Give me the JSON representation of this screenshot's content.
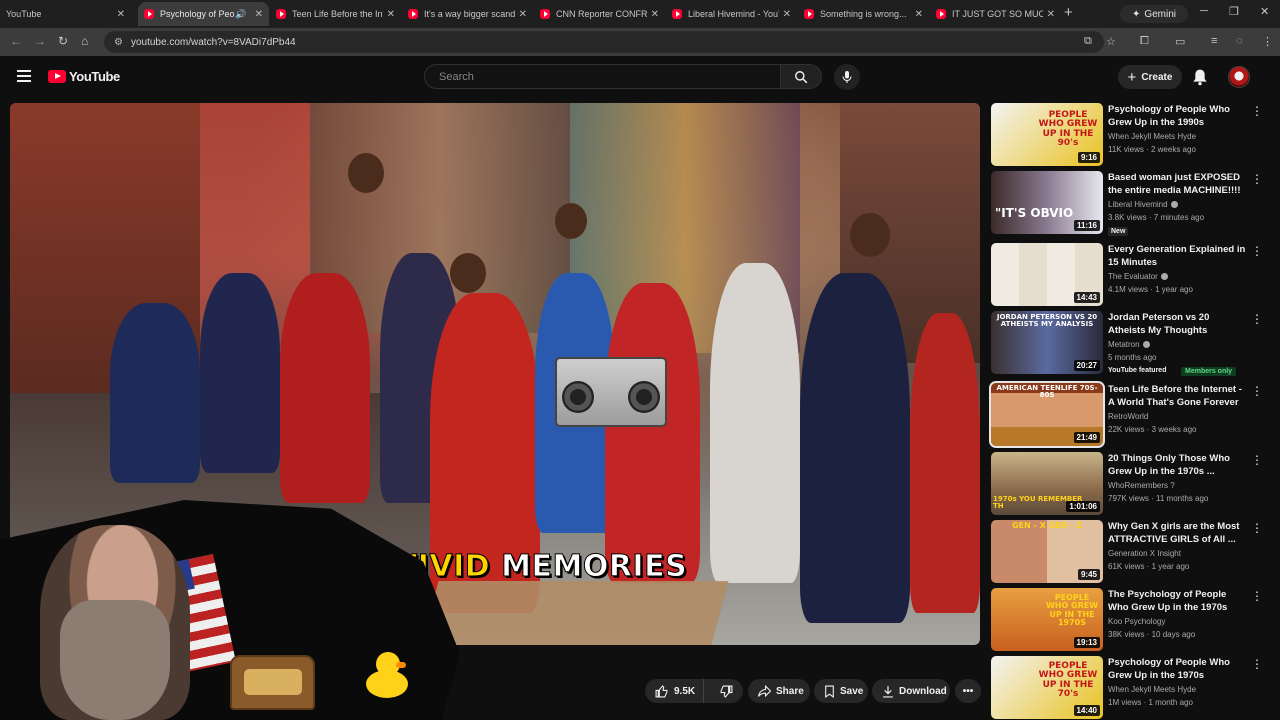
{
  "browser": {
    "tabs": [
      {
        "title": "YouTube",
        "active": false
      },
      {
        "title": "Psychology of People Who Grew Up",
        "active": true
      },
      {
        "title": "Teen Life Before the Internet",
        "active": false
      },
      {
        "title": "It's a way bigger scandal",
        "active": false
      },
      {
        "title": "CNN Reporter CONFRONTED",
        "active": false
      },
      {
        "title": "Liberal Hivemind - YouTube",
        "active": false
      },
      {
        "title": "Something is wrong...",
        "active": false
      },
      {
        "title": "IT JUST GOT SO MUCH",
        "active": false
      }
    ],
    "gemini_label": "Gemini",
    "url": "youtube.com/watch?v=8VADi7dPb44"
  },
  "masthead": {
    "logo_text": "YouTube",
    "search_placeholder": "Search",
    "create_label": "Create"
  },
  "player": {
    "caption_word1": "VIVID",
    "caption_word2": "MEMORIES"
  },
  "actions": {
    "like_count": "9.5K",
    "share_label": "Share",
    "save_label": "Save",
    "download_label": "Download"
  },
  "recommendations": [
    {
      "title": "Psychology of People Who Grew Up in the 1990s",
      "channel": "When Jekyll Meets Hyde",
      "verified": false,
      "meta": "11K views · 2 weeks ago",
      "duration": "9:16",
      "thumb_text": "PEOPLE WHO GREW UP IN THE 90's"
    },
    {
      "title": "Based woman just EXPOSED the entire media MACHINE!!!!",
      "channel": "Liberal Hivemind",
      "verified": true,
      "meta": "3.8K views · 7 minutes ago",
      "duration": "11:16",
      "badge": "New",
      "thumb_text": "\"IT'S OBVIO"
    },
    {
      "title": "Every Generation Explained in 15 Minutes",
      "channel": "The Evaluator",
      "verified": true,
      "meta": "4.1M views · 1 year ago",
      "duration": "14:43",
      "thumb_text": ""
    },
    {
      "title": "Jordan Peterson vs 20 Atheists My Thoughts",
      "channel": "Metatron",
      "verified": true,
      "meta": "5 months ago",
      "duration": "20:27",
      "badge": "YouTube featured",
      "badge2": "Members only",
      "thumb_text": "JORDAN PETERSON VS 20 ATHEISTS MY ANALYSIS"
    },
    {
      "title": "Teen Life Before the Internet - A World That's Gone Forever",
      "channel": "RetroWorld",
      "verified": false,
      "meta": "22K views · 3 weeks ago",
      "duration": "21:49",
      "selected": true,
      "thumb_text": "AMERICAN TEENLIFE 70S-80S"
    },
    {
      "title": "20 Things Only Those Who Grew Up in the 1970s ...",
      "channel": "WhoRemembers ?",
      "verified": false,
      "meta": "797K views · 11 months ago",
      "duration": "1:01:06",
      "thumb_text": "1970s YOU REMEMBER TH"
    },
    {
      "title": "Why Gen X girls are the Most ATTRACTIVE GIRLS of All ...",
      "channel": "Generation X Insight",
      "verified": false,
      "meta": "61K views · 1 year ago",
      "duration": "9:45",
      "thumb_text": "GEN - X  GEN - Z"
    },
    {
      "title": "The Psychology of People Who Grew Up in the 1970s",
      "channel": "Koo Psychology",
      "verified": false,
      "meta": "38K views · 10 days ago",
      "duration": "19:13",
      "thumb_text": "PEOPLE WHO GREW UP IN THE 1970S"
    },
    {
      "title": "Psychology of People Who Grew Up in the 1970s",
      "channel": "When Jekyll Meets Hyde",
      "verified": false,
      "meta": "1M views · 1 month ago",
      "duration": "14:40",
      "thumb_text": "PEOPLE WHO GREW UP IN THE 70's"
    }
  ],
  "colors": {
    "youtube_red": "#ff0033",
    "background": "#0f0f0f",
    "pill": "#272727",
    "caption_yellow": "#ffd500"
  }
}
